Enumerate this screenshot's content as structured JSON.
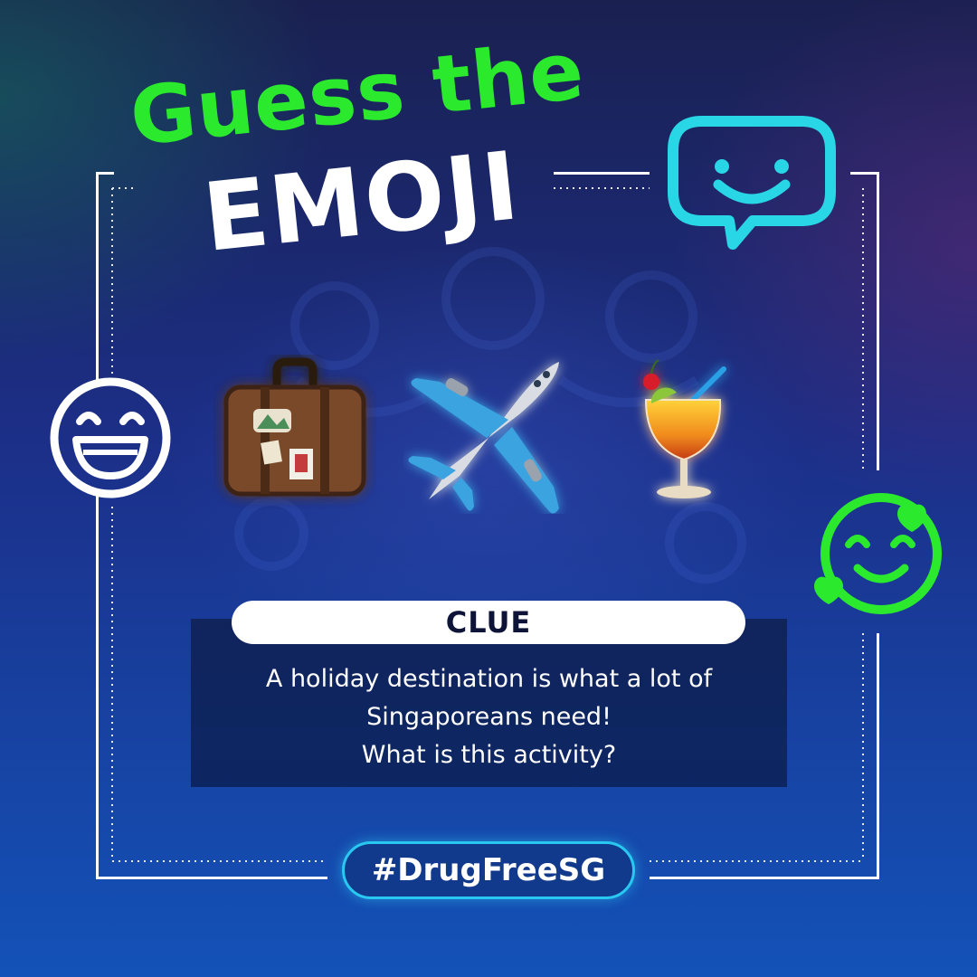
{
  "title": {
    "line1": "Guess the",
    "line2": "EMOJI"
  },
  "emojis": [
    {
      "name": "suitcase-emoji"
    },
    {
      "name": "airplane-emoji"
    },
    {
      "name": "tropical-drink-emoji"
    }
  ],
  "clue": {
    "label": "CLUE",
    "lines": [
      "A holiday destination is what a lot of",
      "Singaporeans need!",
      "What is this activity?"
    ]
  },
  "hashtag": "#DrugFreeSG",
  "icons": [
    "chat-bubble-smile-icon",
    "grinning-face-icon",
    "smiling-face-with-hearts-icon"
  ],
  "colors": {
    "accent_green": "#2bea2e",
    "accent_cyan": "#29d6e6",
    "frame": "#ffffff"
  }
}
